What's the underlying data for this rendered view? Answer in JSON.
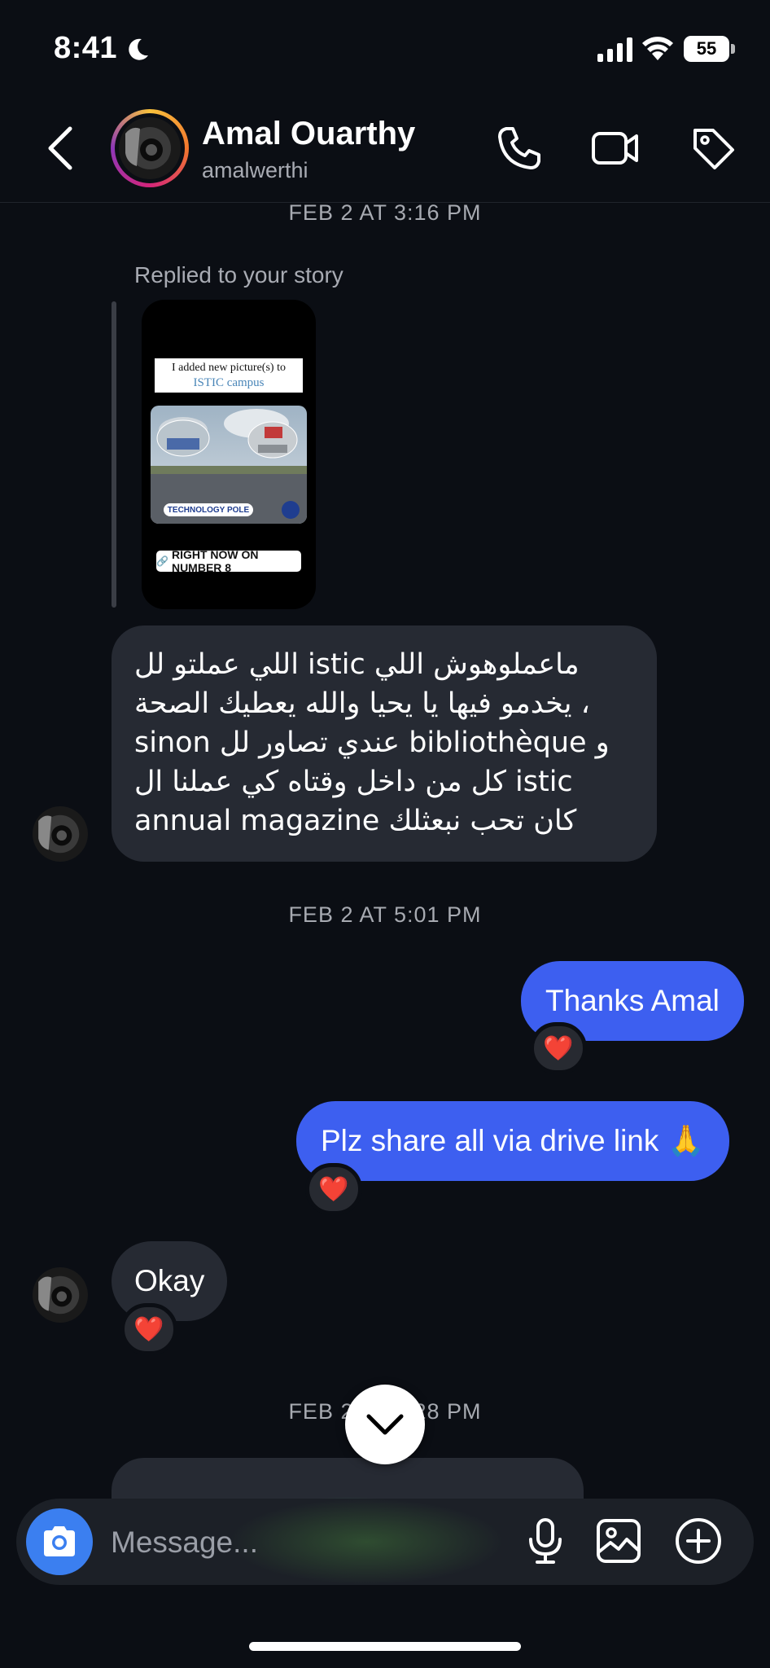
{
  "status_bar": {
    "time": "8:41",
    "battery": "55"
  },
  "header": {
    "name": "Amal Ouarthy",
    "handle": "amalwerthi"
  },
  "conversation": {
    "timestamps": [
      "FEB 2 AT 3:16 PM",
      "FEB 2 AT 5:01 PM",
      "FEB 2 AT 5:28 PM"
    ],
    "story_reply": {
      "label": "Replied to your story",
      "story_title_line1": "I added new picture(s) to",
      "story_title_line2": "ISTIC campus",
      "story_photo_caption": "TECHNOLOGY POLE",
      "story_cta": "RIGHT NOW ON NUMBER 8"
    },
    "incoming_long_lines": [
      "اللي عملتو لل istic ماعملوهوش اللي",
      "يخدمو فيها يا يحيا والله يعطيك الصحة ،",
      "sinon عندي تصاور لل bibliothèque و",
      "كل من داخل وقتاه كي عملنا ال istic",
      "annual magazine كان تحب نبعثلك"
    ],
    "outgoing_1": "Thanks Amal",
    "outgoing_2": "Plz share all via drive link 🙏",
    "incoming_short": "Okay",
    "reaction": "❤️"
  },
  "composer": {
    "placeholder": "Message..."
  },
  "colors": {
    "background": "#0b0e14",
    "outgoing_bubble": "#3d5ff0",
    "incoming_bubble": "#262a33",
    "camera_button": "#3b7ff0"
  }
}
